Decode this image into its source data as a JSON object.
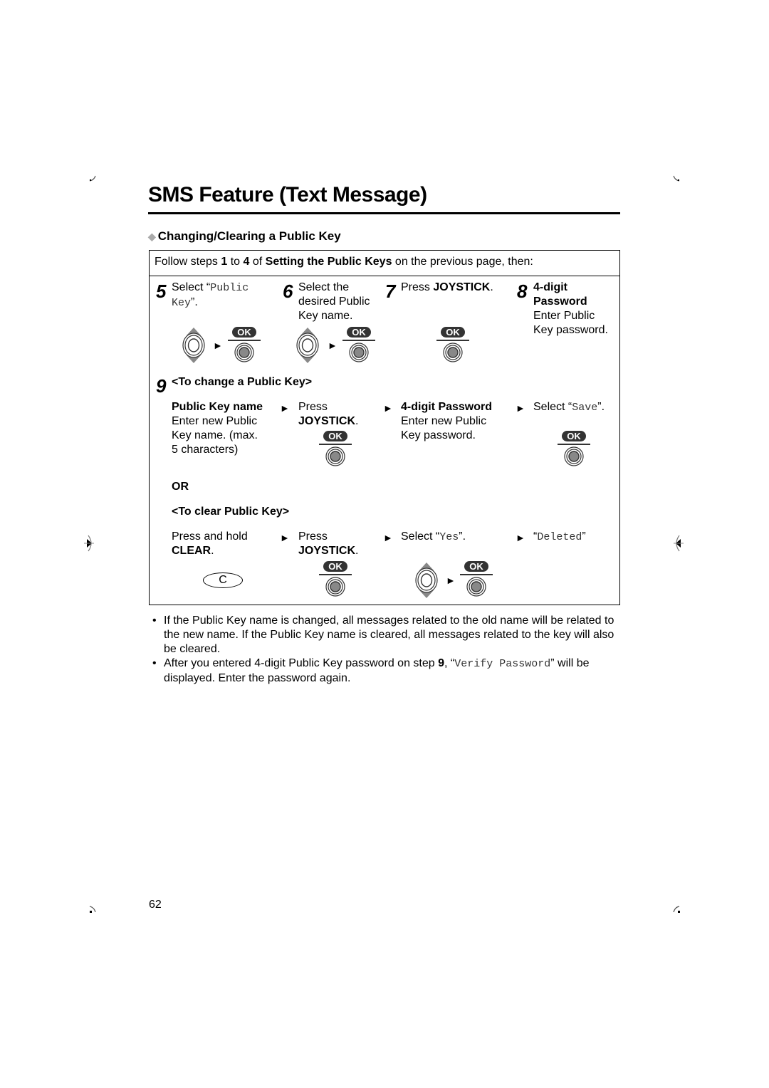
{
  "page": {
    "title": "SMS Feature (Text Message)",
    "page_number": "62"
  },
  "section": {
    "icon": "diamond-icon",
    "heading": "Changing/Clearing a Public Key"
  },
  "intro": {
    "pre": "Follow steps ",
    "from": "1",
    "mid1": " to ",
    "to": "4",
    "mid2": " of ",
    "ref": "Setting the Public Keys",
    "post": " on the previous page, then:"
  },
  "steps": {
    "s5": {
      "num": "5",
      "pre": "Select “",
      "mono": "Public Key",
      "post": "”."
    },
    "s6": {
      "num": "6",
      "text": [
        "Select the",
        "desired Public",
        "Key name."
      ]
    },
    "s7": {
      "num": "7",
      "pre": "Press ",
      "bold": "JOYSTICK",
      "post": "."
    },
    "s8": {
      "num": "8",
      "bold": [
        "4-digit",
        "Password"
      ],
      "text": [
        "Enter Public",
        "Key password."
      ]
    },
    "s9": {
      "num": "9",
      "change_heading": "<To change a Public Key>",
      "change": {
        "c1_bold": "Public Key name",
        "c1_text": [
          "Enter new Public",
          "Key name. (max.",
          "5 characters)"
        ],
        "c2_text": "Press",
        "c2_bold": "JOYSTICK",
        "c3_bold": "4-digit Password",
        "c3_text": [
          "Enter new Public",
          "Key password."
        ],
        "c4_pre": "Select “",
        "c4_mono": "Save",
        "c4_post": "”."
      },
      "or_label": "OR",
      "clear_heading": "<To clear Public Key>",
      "clear": {
        "c1_text": "Press and hold",
        "c1_bold": "CLEAR",
        "c2_text": "Press",
        "c2_bold": "JOYSTICK",
        "c3_pre": "Select “",
        "c3_mono": "Yes",
        "c3_post": "”.",
        "c4_pre": "“",
        "c4_mono": "Deleted",
        "c4_post": "”"
      }
    }
  },
  "keys": {
    "ok_label": "OK",
    "clear_label": "C"
  },
  "notes": [
    {
      "text": "If the Public Key name is changed, all messages related to the old name will be related to the new name. If the Public Key name is cleared, all messages related to the key will also be cleared."
    },
    {
      "pre": "After you entered 4-digit Public Key password on step ",
      "step": "9",
      "mid": ", “",
      "mono": "Verify Password",
      "post": "” will be displayed. Enter the password again."
    }
  ],
  "colors": {
    "text": "#000000",
    "key_fill": "#333333",
    "joystick_arrow": "#888888",
    "diamond": "#aaaaaa"
  }
}
